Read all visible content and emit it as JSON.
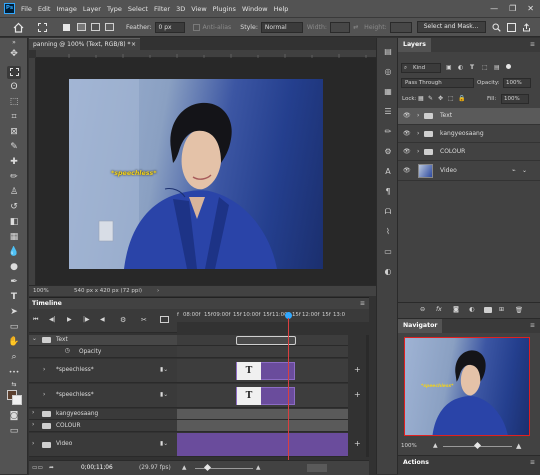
{
  "app": {
    "logo": "Ps"
  },
  "menubar": {
    "items": [
      "File",
      "Edit",
      "Image",
      "Layer",
      "Type",
      "Select",
      "Filter",
      "3D",
      "View",
      "Plugins",
      "Window",
      "Help"
    ],
    "window_controls": {
      "minimize": "—",
      "restore": "❐",
      "close": "✕"
    }
  },
  "options": {
    "feather_label": "Feather:",
    "feather_value": "0 px",
    "anti_alias": "Anti-alias",
    "style_label": "Style:",
    "style_value": "Normal",
    "width_label": "Width:",
    "height_label": "Height:",
    "select_mask": "Select and Mask..."
  },
  "document": {
    "tab_title": "panning @ 100% (Text, RGB/8) *",
    "tab_close": "×",
    "status_zoom": "100%",
    "status_info": "540 px x 420 px (72 ppi)",
    "status_arrow": "›",
    "caption": "*speechless*"
  },
  "timeline": {
    "title": "Timeline",
    "ruler_labels": [
      "f",
      "08:00f",
      "15f",
      "09:00f",
      "15f",
      "10:00f",
      "15f",
      "11:00f",
      "15f",
      "12:00f",
      "15f",
      "13:0"
    ],
    "layers": [
      {
        "name": "Text",
        "type": "group",
        "expanded": true
      },
      {
        "name": "Opacity",
        "type": "property"
      },
      {
        "name": "*speechless*",
        "type": "text"
      },
      {
        "name": "*speechless*",
        "type": "text"
      },
      {
        "name": "kangyeosaang",
        "type": "group"
      },
      {
        "name": "COLOUR",
        "type": "group"
      },
      {
        "name": "Video",
        "type": "group"
      }
    ],
    "timecode": "0;00;11;06",
    "fps": "(29.97 fps)",
    "add": "+",
    "text_glyph": "T"
  },
  "layers_panel": {
    "tab": "Layers",
    "kind_label": "Kind",
    "blend_mode": "Pass Through",
    "opacity_label": "Opacity:",
    "opacity_value": "100%",
    "lock_label": "Lock:",
    "fill_label": "Fill:",
    "fill_value": "100%",
    "layers": [
      {
        "name": "Text",
        "selected": true
      },
      {
        "name": "kangyeosaang",
        "selected": false
      },
      {
        "name": "COLOUR",
        "selected": false
      },
      {
        "name": "Video",
        "selected": false
      }
    ],
    "footer_icons": [
      "link-icon",
      "fx-icon",
      "mask-icon",
      "adjustment-icon",
      "folder-icon",
      "new-layer-icon",
      "trash-icon"
    ],
    "fx_label": "fx"
  },
  "navigator": {
    "tab": "Navigator",
    "zoom": "100%",
    "caption": "*speechless*"
  },
  "actions": {
    "tab": "Actions"
  },
  "colors": {
    "accent_blue": "#31a8ff",
    "clip_purple": "#6a4c9c",
    "playhead_red": "#d94040",
    "nav_frame_red": "#e02020"
  }
}
